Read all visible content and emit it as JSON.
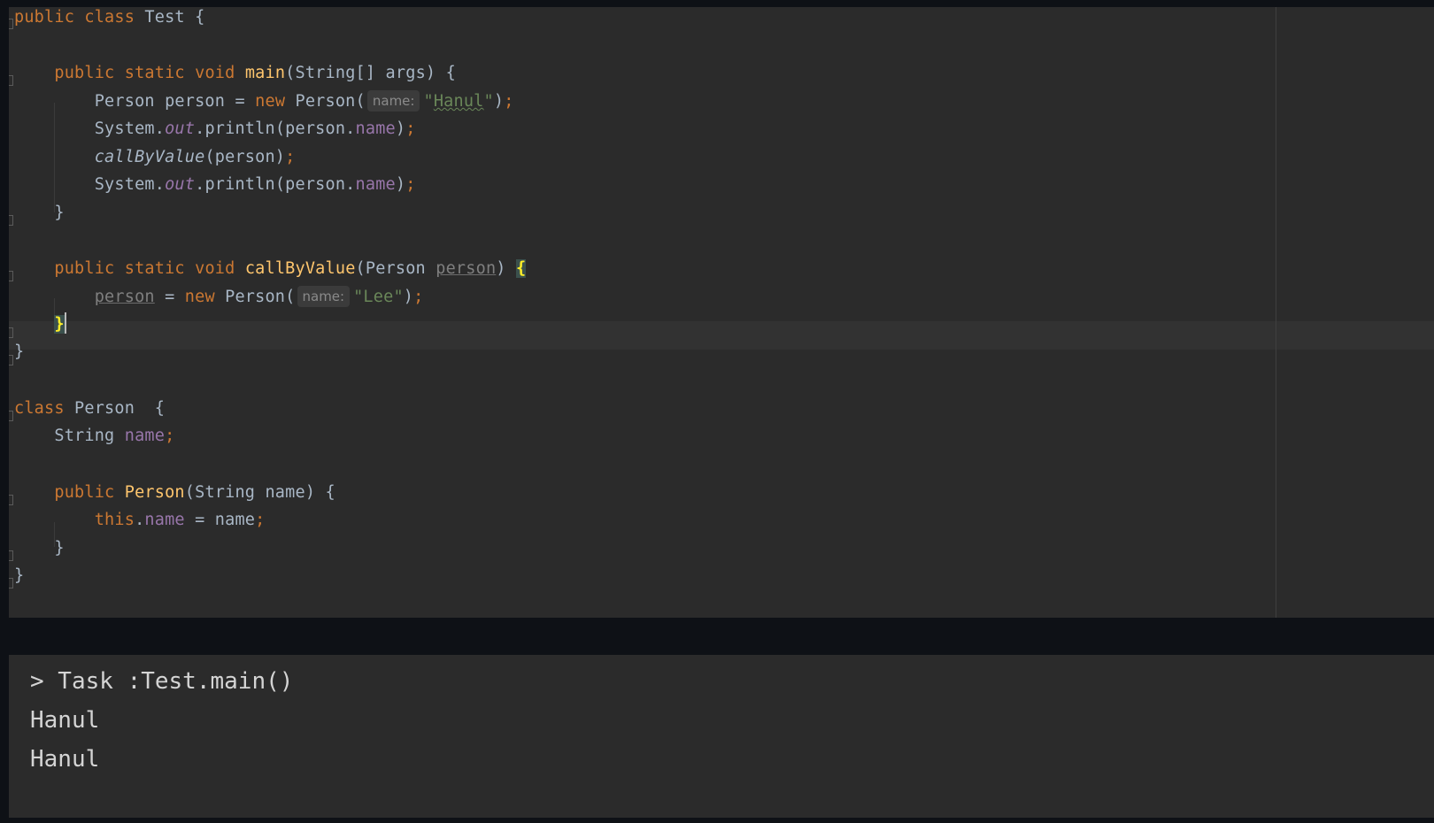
{
  "editor": {
    "language": "Java",
    "lines": {
      "l1": {
        "kw1": "public",
        "kw2": "class",
        "name": "Test",
        "rest": " {"
      },
      "l3": {
        "kw1": "public",
        "kw2": "static",
        "kw3": "void",
        "fn": "main",
        "rest": "(String[] args) {"
      },
      "l4": {
        "pre": "Person person = ",
        "kw": "new",
        "call": " Person(",
        "hint": "name:",
        "str_q1": "\"",
        "str": "Hanul",
        "str_q2": "\"",
        "close": ")",
        "semi": ";"
      },
      "l5": {
        "pre": "System.",
        "stat": "out",
        "mid": ".println(person.",
        "fld": "name",
        "close": ")",
        "semi": ";"
      },
      "l6": {
        "fn": "callByValue",
        "args": "(person)",
        "semi": ";"
      },
      "l7": {
        "pre": "System.",
        "stat": "out",
        "mid": ".println(person.",
        "fld": "name",
        "close": ")",
        "semi": ";"
      },
      "l8": {
        "text": "}"
      },
      "l10": {
        "kw1": "public",
        "kw2": "static",
        "kw3": "void",
        "fn": "callByValue",
        "open": "(Person ",
        "param": "person",
        "close": ") ",
        "brace": "{"
      },
      "l11": {
        "param": "person",
        "mid": " = ",
        "kw": "new",
        "call": " Person(",
        "hint": "name:",
        "str": "\"Lee\"",
        "close": ")",
        "semi": ";"
      },
      "l12": {
        "brace": "}"
      },
      "l13": {
        "text": "}"
      },
      "l15": {
        "kw": "class",
        "name": " Person  {"
      },
      "l16": {
        "type": "String ",
        "fld": "name",
        "semi": ";"
      },
      "l18": {
        "kw": "public",
        "fn": "Person",
        "rest": "(String name) {"
      },
      "l19": {
        "kw": "this",
        "dot": ".",
        "fld": "name",
        "rest": " = name",
        "semi": ";"
      },
      "l20": {
        "text": "}"
      },
      "l21": {
        "text": "}"
      }
    }
  },
  "console": {
    "lines": [
      "> Task :Test.main()",
      "Hanul",
      "Hanul"
    ]
  }
}
